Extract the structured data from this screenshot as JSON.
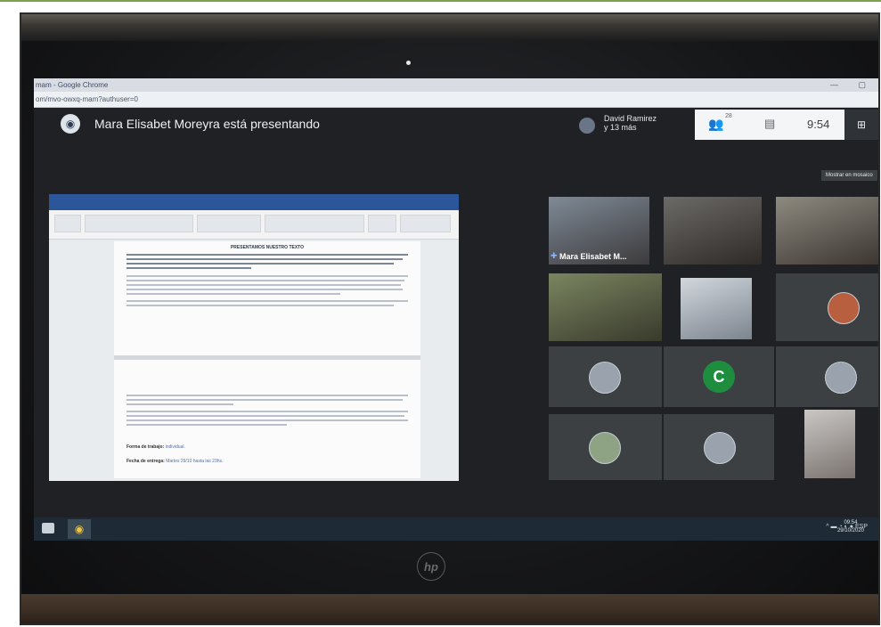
{
  "chrome": {
    "window_title": "mam - Google Chrome",
    "url": "om/mvo-owxq-mam?authuser=0"
  },
  "meet": {
    "presenting_text": "Mara Elisabet Moreyra está presentando",
    "participants_name": "David Ramirez",
    "participants_more": "y 13 más",
    "people_count": "28",
    "time": "9:54",
    "tooltip": "Mostrar en mosaico"
  },
  "document": {
    "heading": "PRESENTAMOS NUESTRO TEXTO",
    "work_form_label": "Forma de trabajo:",
    "work_form_value": "individual.",
    "delivery_label": "Fecha de entrega:",
    "delivery_value": "Martes 29/10 hasta las 23hs."
  },
  "grid": {
    "pinned_name": "Mara Elisabet M...",
    "letter_avatar": "C"
  },
  "taskbar": {
    "language": "ESP",
    "time": "09:54",
    "date": "29/10/2020"
  },
  "brand": {
    "laptop_logo": "hp"
  }
}
